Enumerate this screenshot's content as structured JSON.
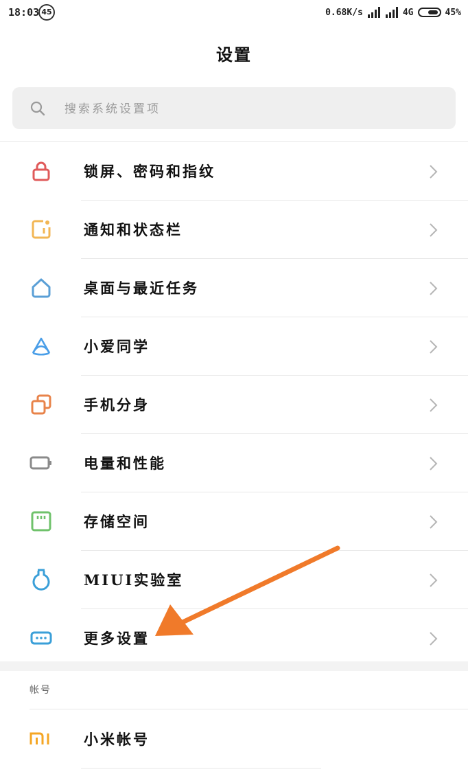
{
  "status_bar": {
    "time": "18:03",
    "badge": "45",
    "speed": "0.68K/s",
    "network": "4G",
    "battery": "45%"
  },
  "header": {
    "title": "设置"
  },
  "search": {
    "placeholder": "搜索系统设置项",
    "icon": "search-icon"
  },
  "menu": [
    {
      "label": "锁屏、密码和指纹",
      "icon": "lock-icon",
      "color": "#e05a5a"
    },
    {
      "label": "通知和状态栏",
      "icon": "notification-icon",
      "color": "#f2b654"
    },
    {
      "label": "桌面与最近任务",
      "icon": "home-icon",
      "color": "#5a9fd6"
    },
    {
      "label": "小爱同学",
      "icon": "xiaoai-icon",
      "color": "#4a9ee8"
    },
    {
      "label": "手机分身",
      "icon": "dual-apps-icon",
      "color": "#e8834a"
    },
    {
      "label": "电量和性能",
      "icon": "battery-icon",
      "color": "#8a8a8a"
    },
    {
      "label": "存储空间",
      "icon": "storage-icon",
      "color": "#6fc26b"
    },
    {
      "label": "MIUI实验室",
      "icon": "lab-flask-icon",
      "color": "#3a9fd8"
    },
    {
      "label": "更多设置",
      "icon": "more-settings-icon",
      "color": "#3a9fd8"
    }
  ],
  "account_section": {
    "title": "帐号",
    "items": [
      {
        "label": "小米帐号",
        "icon": "mi-logo-icon",
        "color": "#f5a623"
      }
    ]
  },
  "annotation": {
    "arrow_color": "#f07a2a"
  }
}
